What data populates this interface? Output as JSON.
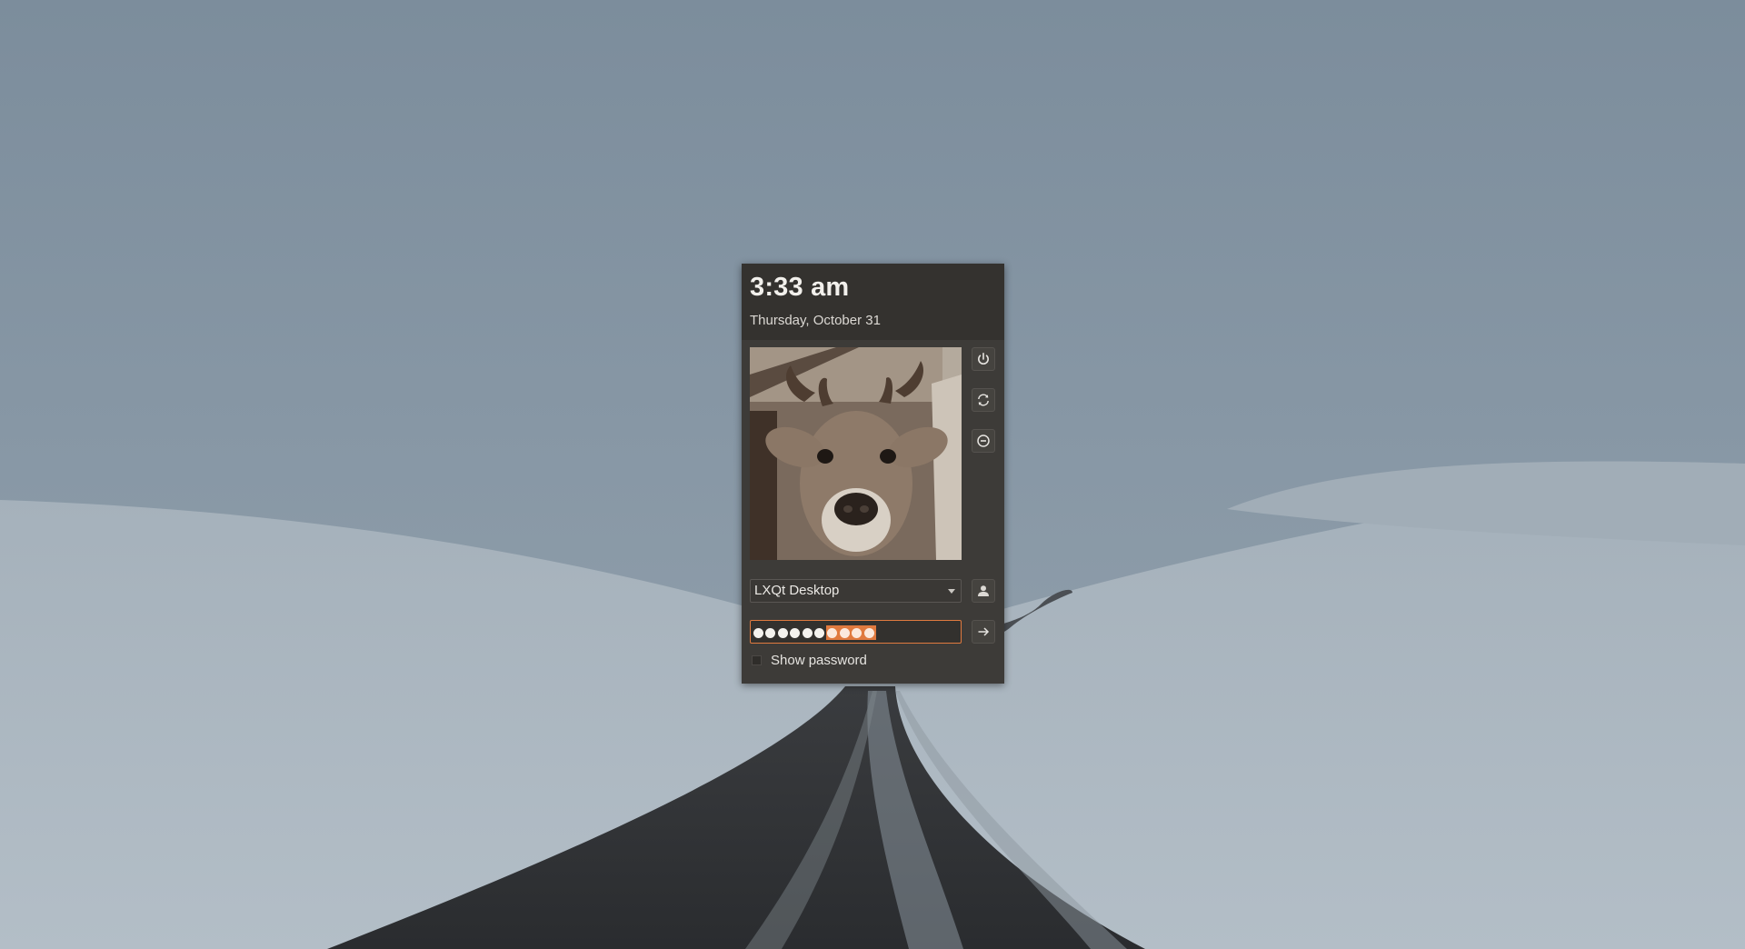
{
  "greeter": {
    "clock": "3:33 am",
    "date": "Thursday, October 31",
    "session": {
      "selected": "LXQt Desktop"
    },
    "password": {
      "masked_count": 10,
      "selected_count": 4
    },
    "show_password_label": "Show password",
    "show_password_checked": false,
    "buttons": {
      "power_icon": "power-icon",
      "restart_icon": "restart-icon",
      "suspend_icon": "suspend-icon",
      "user_icon": "user-icon",
      "login_icon": "arrow-right-icon"
    }
  },
  "colors": {
    "panel_bg": "#3d3b38",
    "header_bg": "#34322f",
    "accent": "#e07a3f"
  }
}
